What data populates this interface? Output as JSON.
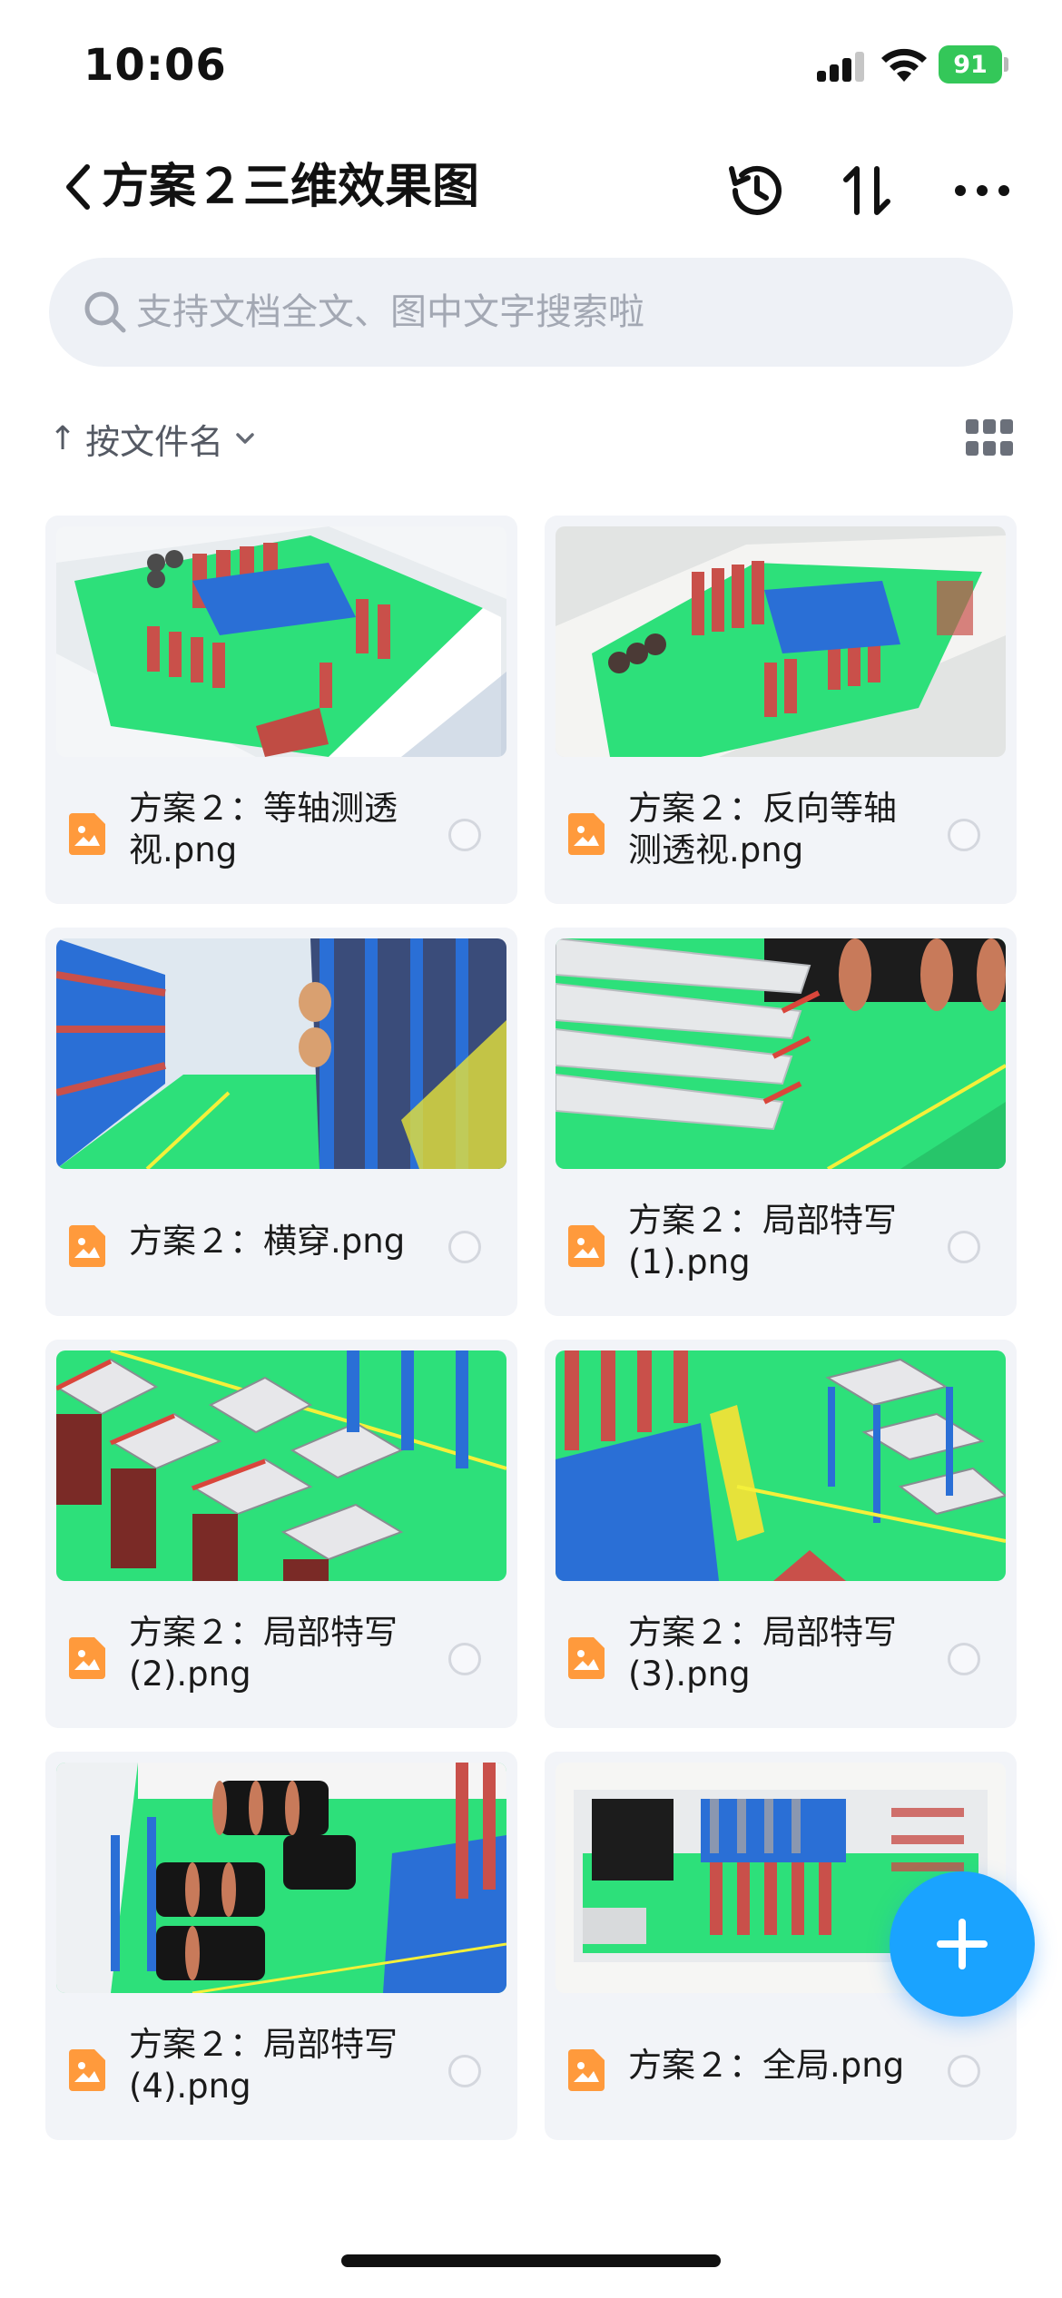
{
  "status_bar": {
    "time": "10:06",
    "battery_level": "91",
    "icons": [
      "signal-icon",
      "wifi-icon",
      "battery-icon"
    ]
  },
  "header": {
    "back_icon": "chevron-left-icon",
    "title": "方案２三维效果图",
    "actions": [
      "history-icon",
      "sort-order-icon",
      "more-icon"
    ]
  },
  "search": {
    "placeholder": "支持文档全文、图中文字搜索啦"
  },
  "sort_bar": {
    "arrow": "↑",
    "label": "按文件名",
    "view_icon": "grid-view-icon"
  },
  "files": [
    {
      "name": "方案２：等轴测透视.png",
      "file_icon": "image-file-icon",
      "thumbnail": "warehouse-isometric"
    },
    {
      "name": "方案２：反向等轴测透视.png",
      "file_icon": "image-file-icon",
      "thumbnail": "warehouse-reverse-isometric"
    },
    {
      "name": "方案２：横穿.png",
      "file_icon": "image-file-icon",
      "thumbnail": "aisle-walkthrough"
    },
    {
      "name": "方案２：局部特写(1).png",
      "file_icon": "image-file-icon",
      "thumbnail": "pipe-rack-closeup"
    },
    {
      "name": "方案２：局部特写(2).png",
      "file_icon": "image-file-icon",
      "thumbnail": "shelving-closeup"
    },
    {
      "name": "方案２：局部特写(3).png",
      "file_icon": "image-file-icon",
      "thumbnail": "mezzanine-closeup"
    },
    {
      "name": "方案２：局部特写(4).png",
      "file_icon": "image-file-icon",
      "thumbnail": "cable-reel-closeup"
    },
    {
      "name": "方案２：全局.png",
      "file_icon": "image-file-icon",
      "thumbnail": "overall-view"
    }
  ],
  "fab": {
    "icon": "plus-icon"
  },
  "colors": {
    "accent": "#1aa3ff",
    "card_bg": "#f2f4f8",
    "search_bg": "#eef1f6",
    "file_icon": "#ff9a3c",
    "battery": "#34c759",
    "floor_green": "#2de07a",
    "rack_blue": "#2a6fd6",
    "shelf_red": "#d9463b"
  }
}
